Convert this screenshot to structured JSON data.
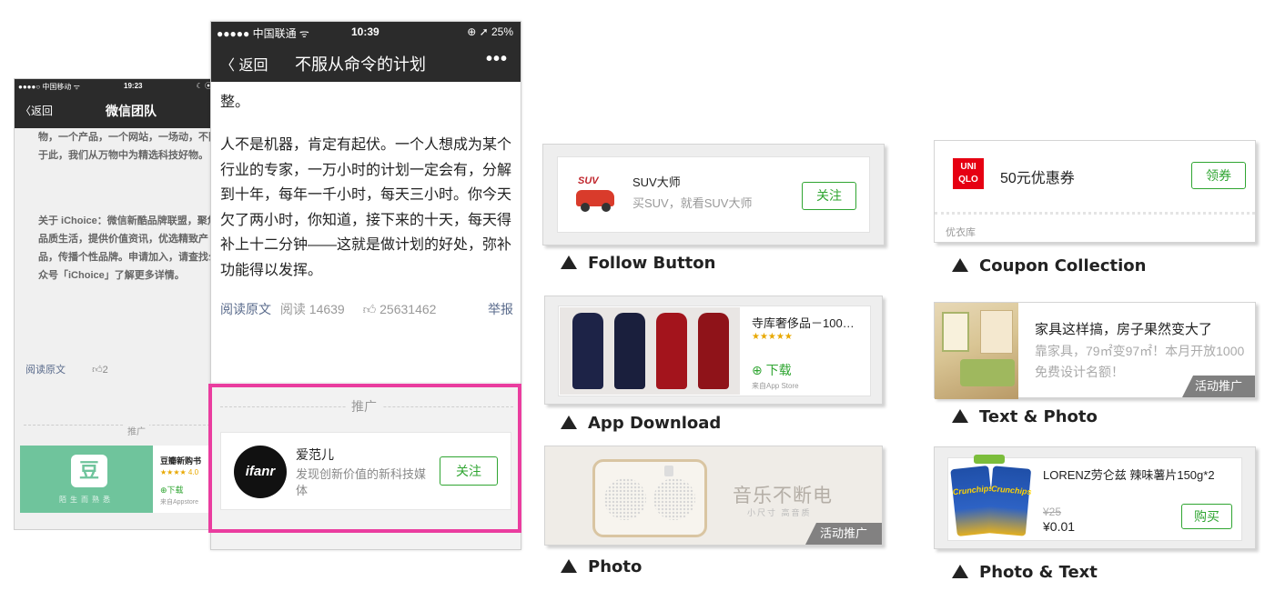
{
  "back_phone": {
    "status": {
      "carrier": "●●●●○ 中国移动 ᯤ",
      "time": "19:23",
      "icons": "☾ ⦿"
    },
    "nav": {
      "back": "〈返回",
      "title": "微信团队"
    },
    "para1": "物，一个产品，一个网站，一场动，不限于此，我们从万物中为精选科技好物。",
    "para2": "关于 iChoice：微信新酷品牌联盟，聚焦品质生活，提供价值资讯，优选精致产品，传播个性品牌。申请加入，请查找公众号「iChoice」了解更多详情。",
    "read_original": "阅读原文",
    "likes": "2",
    "ad_label": "推广",
    "ad": {
      "logo": "豆",
      "slogan": "陌生而熟悉",
      "name": "豆瓣新购书",
      "stars": "★★★★ 4.0",
      "download": "⊕下载",
      "source": "来自Appstore"
    }
  },
  "front_phone": {
    "status": {
      "carrier": "●●●●● 中国联通 ᯤ",
      "time": "10:39",
      "icons": "⊕ ➚ 25%"
    },
    "nav": {
      "back": "〈 返回",
      "title": "不服从命令的计划",
      "more": "•••"
    },
    "text_top": "整。",
    "text_main": "人不是机器，肯定有起伏。一个人想成为某个行业的专家，一万小时的计划一定会有，分解到十年，每年一千小时，每天三小时。你今天欠了两小时，你知道，接下来的十天，每天得补上十二分钟——这就是做计划的好处，弥补功能得以发挥。",
    "read_original": "阅读原文",
    "reads": "阅读 14639",
    "likes": "25631462",
    "report": "举报",
    "ad_label": "推广",
    "ad": {
      "logo_text": "ifanr",
      "name": "爱范儿",
      "desc": "发现创新价值的新科技媒体",
      "follow": "关注"
    }
  },
  "examples": {
    "follow": {
      "brand": "SUV",
      "name": "SUV大师",
      "desc": "买SUV，就看SUV大师",
      "button": "关注",
      "caption": "Follow Button"
    },
    "app": {
      "name": "寺库奢侈品－100…",
      "stars": "★★★★★",
      "download": "⊕ 下载",
      "source": "来自App Store",
      "caption": "App Download"
    },
    "photo": {
      "slogan": "音乐不断电",
      "sub": "小尺寸 高音质",
      "tag": "活动推广",
      "caption": "Photo"
    },
    "coupon": {
      "logo": "UNI QLO",
      "title": "50元优惠券",
      "button": "领券",
      "shop": "优衣库",
      "caption": "Coupon Collection"
    },
    "text_photo": {
      "title": "家具这样搞，房子果然变大了",
      "desc": "靠家具，79㎡变97㎡！本月开放1000免费设计名额！",
      "tag": "活动推广",
      "caption": "Text & Photo"
    },
    "photo_text": {
      "bag": "Crunchips",
      "name": "LORENZ劳仑兹 辣味薯片150g*2",
      "old_price": "¥25",
      "price": "¥0.01",
      "button": "购买",
      "caption": "Photo & Text"
    }
  },
  "colors": {
    "accent_green": "#2fa531",
    "highlight_pink": "#ea3d9f",
    "nav_dark": "#2b2b2b"
  }
}
